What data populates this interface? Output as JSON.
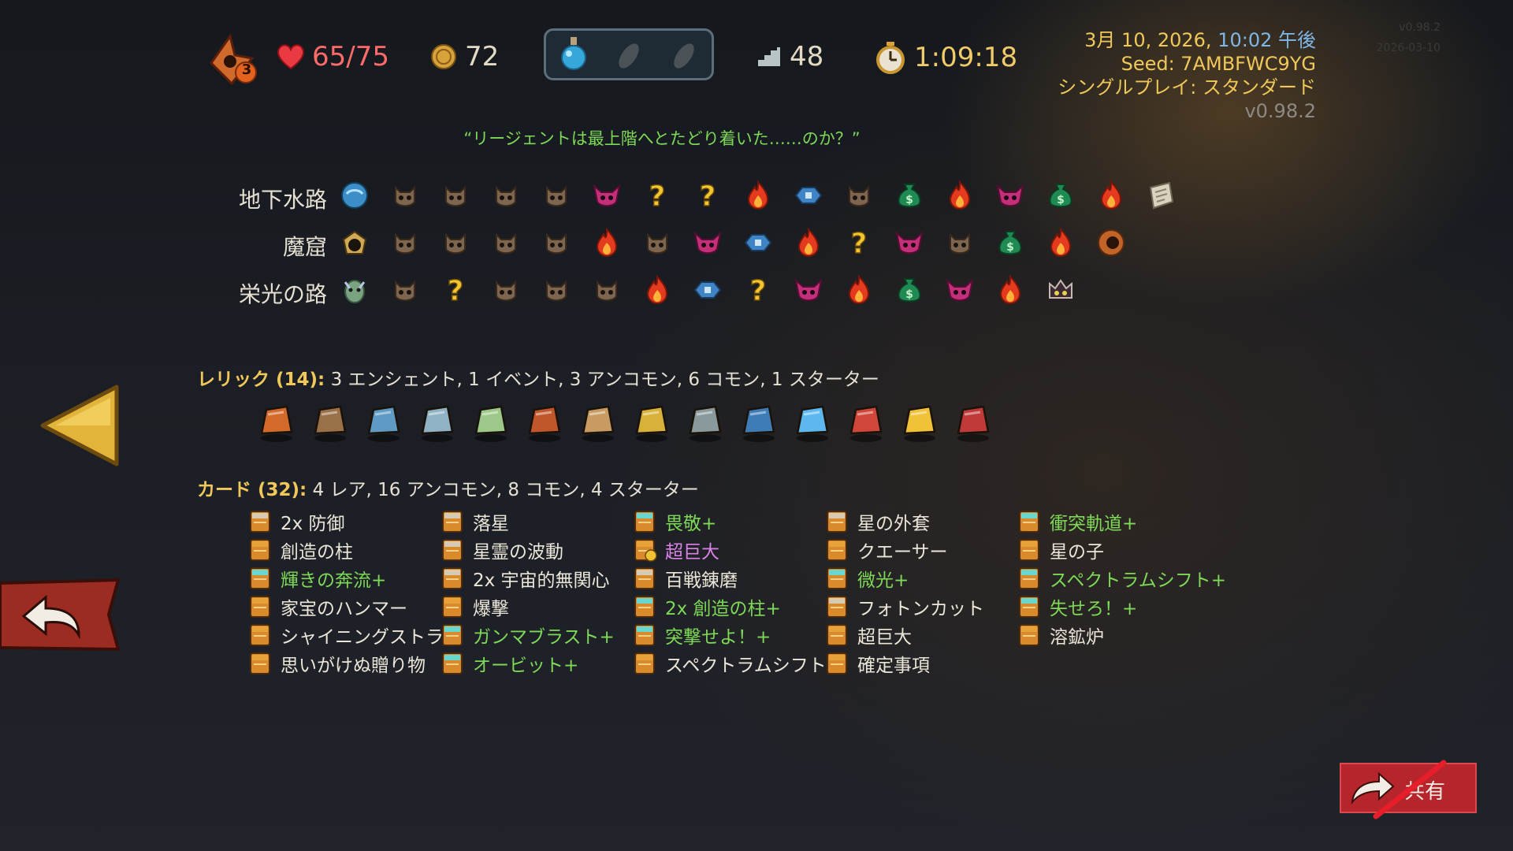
{
  "hud": {
    "ascension": "3",
    "hp": "65/75",
    "gold": "72",
    "floor": "48",
    "time": "1:09:18"
  },
  "run_info": {
    "date": "3月 10, 2026,",
    "time": "10:02 午後",
    "seed": "Seed: 7AMBFWC9YG",
    "mode": "シングルプレイ: スタンダード",
    "version": "v0.98.2",
    "watermark_version": "v0.98.2",
    "watermark_date": "2026-03-10"
  },
  "quote": "“リージェントは最上階へとたどり着いた……のか？”",
  "acts": [
    {
      "name": "地下水路",
      "boss_icon": "sewer-boss-icon",
      "nodes": [
        "monster",
        "monster",
        "monster",
        "monster",
        "elite",
        "unknown",
        "unknown",
        "rest",
        "treasure",
        "monster",
        "merchant",
        "rest",
        "elite",
        "merchant",
        "rest",
        "boss-scroll"
      ]
    },
    {
      "name": "魔窟",
      "boss_icon": "hive-boss-icon",
      "nodes": [
        "monster",
        "monster",
        "monster",
        "monster",
        "rest",
        "monster",
        "elite",
        "treasure",
        "rest",
        "unknown",
        "elite",
        "monster",
        "merchant",
        "rest",
        "boss-orb"
      ]
    },
    {
      "name": "栄光の路",
      "boss_icon": "glory-boss-icon",
      "nodes": [
        "monster",
        "unknown",
        "monster",
        "monster",
        "monster",
        "rest",
        "treasure",
        "unknown",
        "elite",
        "rest",
        "merchant",
        "elite",
        "rest",
        "boss-crown"
      ]
    }
  ],
  "relics": {
    "title": "レリック (14):",
    "summary": "3 エンシェント, 1 イベント, 3 アンコモン, 6 コモン, 1 スターター",
    "items": [
      "crystal-rock-relic",
      "wooden-bundle-relic",
      "anvil-relic",
      "tarnished-plate-relic",
      "green-gun-relic",
      "pumpkin-face-relic",
      "backpack-relic",
      "sunflower-pot-relic",
      "newtons-cradle-relic",
      "trident-relic",
      "spirit-ghost-relic",
      "horn-relic",
      "banana-relic",
      "red-box-relic"
    ]
  },
  "cards": {
    "title": "カード (32):",
    "summary": "4 レア, 16 アンコモン, 8 コモン, 4 スターター",
    "columns": [
      [
        {
          "name": "2x 防御",
          "type": "basic"
        },
        {
          "name": "創造の柱",
          "type": "normal"
        },
        {
          "name": "輝きの奔流+",
          "type": "upgraded"
        },
        {
          "name": "家宝のハンマー",
          "type": "normal"
        },
        {
          "name": "シャイニングストラ…",
          "type": "normal"
        },
        {
          "name": "思いがけぬ贈り物",
          "type": "normal"
        }
      ],
      [
        {
          "name": "落星",
          "type": "basic"
        },
        {
          "name": "星霊の波動",
          "type": "basic"
        },
        {
          "name": "2x 宇宙的無関心",
          "type": "basic"
        },
        {
          "name": "爆撃",
          "type": "normal"
        },
        {
          "name": "ガンマブラスト+",
          "type": "upgraded"
        },
        {
          "name": "オービット+",
          "type": "upgraded"
        }
      ],
      [
        {
          "name": "畏敬+",
          "type": "upgraded"
        },
        {
          "name": "超巨大",
          "type": "rare"
        },
        {
          "name": "百戦錬磨",
          "type": "basic"
        },
        {
          "name": "2x 創造の柱+",
          "type": "upgraded"
        },
        {
          "name": "突撃せよ！+",
          "type": "upgraded"
        },
        {
          "name": "スペクトラムシフト",
          "type": "normal"
        }
      ],
      [
        {
          "name": "星の外套",
          "type": "basic"
        },
        {
          "name": "クエーサー",
          "type": "normal"
        },
        {
          "name": "微光+",
          "type": "upgraded"
        },
        {
          "name": "フォトンカット",
          "type": "basic"
        },
        {
          "name": "超巨大",
          "type": "normal"
        },
        {
          "name": "確定事項",
          "type": "normal"
        }
      ],
      [
        {
          "name": "衝突軌道+",
          "type": "upgraded"
        },
        {
          "name": "星の子",
          "type": "normal"
        },
        {
          "name": "スペクトラムシフト+",
          "type": "upgraded"
        },
        {
          "name": "失せろ！+",
          "type": "upgraded"
        },
        {
          "name": "溶鉱炉",
          "type": "normal"
        }
      ]
    ]
  },
  "nav": {
    "share_label": "共有"
  },
  "colors": {
    "gold_text": "#f0c85a",
    "upgraded_text": "#7ed957",
    "rare_text": "#d983e6",
    "hp_text": "#ff6a6a",
    "share_button": "#b7252c"
  }
}
